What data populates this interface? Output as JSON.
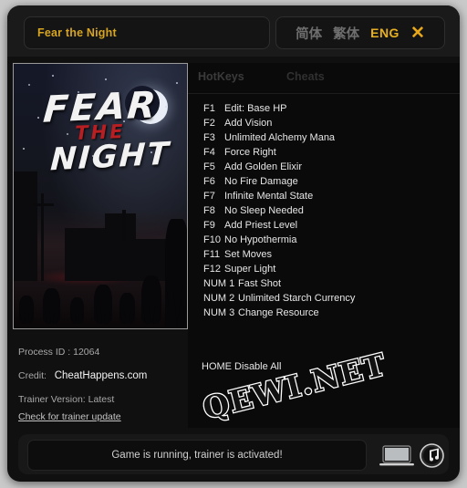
{
  "titlebar": {
    "game_title": "Fear the Night",
    "languages": [
      {
        "label": "简体",
        "active": false
      },
      {
        "label": "繁体",
        "active": false
      },
      {
        "label": "ENG",
        "active": true
      }
    ],
    "close_label": "✕"
  },
  "cover": {
    "line1": "FEAR",
    "line2": "THE",
    "line3": "NIGHT"
  },
  "info": {
    "process_label": "Process ID :",
    "process_value": "12064",
    "credit_label": "Credit:",
    "credit_value": "CheatHappens.com",
    "version_label": "Trainer Version:",
    "version_value": "Latest",
    "update_link": "Check for trainer update"
  },
  "tabs": [
    {
      "label": "HotKeys",
      "active": true
    },
    {
      "label": "Cheats",
      "active": false
    }
  ],
  "hotkeys": [
    {
      "key": "F1",
      "desc": "Edit: Base HP"
    },
    {
      "key": "F2",
      "desc": "Add Vision"
    },
    {
      "key": "F3",
      "desc": "Unlimited Alchemy Mana"
    },
    {
      "key": "F4",
      "desc": "Force Right"
    },
    {
      "key": "F5",
      "desc": "Add Golden Elixir"
    },
    {
      "key": "F6",
      "desc": "No Fire Damage"
    },
    {
      "key": "F7",
      "desc": "Infinite Mental State"
    },
    {
      "key": "F8",
      "desc": "No Sleep Needed"
    },
    {
      "key": "F9",
      "desc": "Add Priest Level"
    },
    {
      "key": "F10",
      "desc": "No Hypothermia"
    },
    {
      "key": "F11",
      "desc": "Set Moves"
    },
    {
      "key": "F12",
      "desc": "Super Light"
    },
    {
      "key": "NUM 1",
      "desc": "Fast Shot"
    },
    {
      "key": "NUM 2",
      "desc": "Unlimited Starch Currency"
    },
    {
      "key": "NUM 3",
      "desc": "Change Resource"
    }
  ],
  "global_hotkey": "HOME Disable All",
  "watermark": "QEWI.NET",
  "bottombar": {
    "status": "Game is running, trainer is activated!"
  },
  "colors": {
    "accent_gold": "#d8a520",
    "window_bg": "#101010",
    "content_bg": "#0a0a0a",
    "text_primary": "#e6e6e6"
  }
}
